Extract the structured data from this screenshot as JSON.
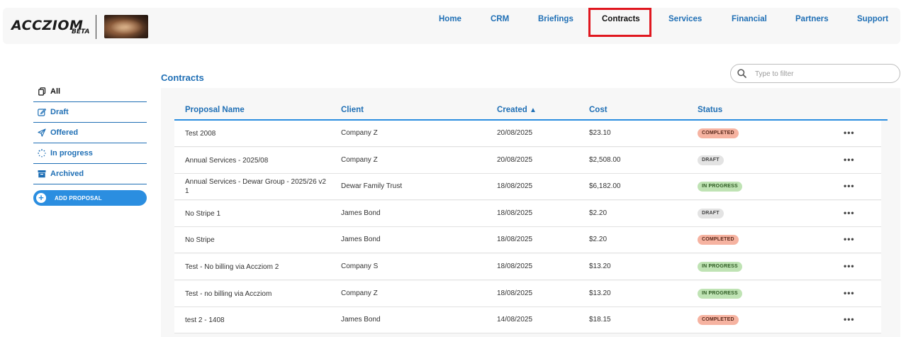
{
  "brand": {
    "name": "ACCZIOM",
    "tag": "BETA"
  },
  "nav": {
    "items": [
      {
        "label": "Home"
      },
      {
        "label": "CRM"
      },
      {
        "label": "Briefings"
      },
      {
        "label": "Contracts"
      },
      {
        "label": "Services"
      },
      {
        "label": "Financial"
      },
      {
        "label": "Partners"
      },
      {
        "label": "Support"
      }
    ],
    "active": "Contracts"
  },
  "sidebar": {
    "items": [
      {
        "label": "All",
        "icon": "copy-icon"
      },
      {
        "label": "Draft",
        "icon": "edit-icon"
      },
      {
        "label": "Offered",
        "icon": "send-icon"
      },
      {
        "label": "In progress",
        "icon": "spinner-icon"
      },
      {
        "label": "Archived",
        "icon": "archive-icon"
      }
    ],
    "add_label": "ADD PROPOSAL"
  },
  "main": {
    "title": "Contracts",
    "search_placeholder": "Type to filter",
    "columns": [
      "Proposal Name",
      "Client",
      "Created",
      "Cost",
      "Status"
    ],
    "sort_indicator": "▲",
    "rows": [
      {
        "name": "Test 2008",
        "client": "Company Z",
        "created": "20/08/2025",
        "cost": "$23.10",
        "status": "COMPLETED"
      },
      {
        "name": "Annual Services - 2025/08",
        "client": "Company Z",
        "created": "20/08/2025",
        "cost": "$2,508.00",
        "status": "DRAFT"
      },
      {
        "name": "Annual Services - Dewar Group - 2025/26 v2 1",
        "client": "Dewar Family Trust",
        "created": "18/08/2025",
        "cost": "$6,182.00",
        "status": "IN PROGRESS"
      },
      {
        "name": "No Stripe 1",
        "client": "James Bond",
        "created": "18/08/2025",
        "cost": "$2.20",
        "status": "DRAFT"
      },
      {
        "name": "No Stripe",
        "client": "James Bond",
        "created": "18/08/2025",
        "cost": "$2.20",
        "status": "COMPLETED"
      },
      {
        "name": "Test - No billing via Accziom 2",
        "client": "Company S",
        "created": "18/08/2025",
        "cost": "$13.20",
        "status": "IN PROGRESS"
      },
      {
        "name": "Test - no billing via Accziom",
        "client": "Company Z",
        "created": "18/08/2025",
        "cost": "$13.20",
        "status": "IN PROGRESS"
      },
      {
        "name": "test 2 - 1408",
        "client": "James Bond",
        "created": "14/08/2025",
        "cost": "$18.15",
        "status": "COMPLETED"
      }
    ],
    "row_menu": "•••"
  },
  "colors": {
    "accent": "#1f6fb5",
    "button": "#2b8ee0",
    "highlight": "#e0171f"
  }
}
